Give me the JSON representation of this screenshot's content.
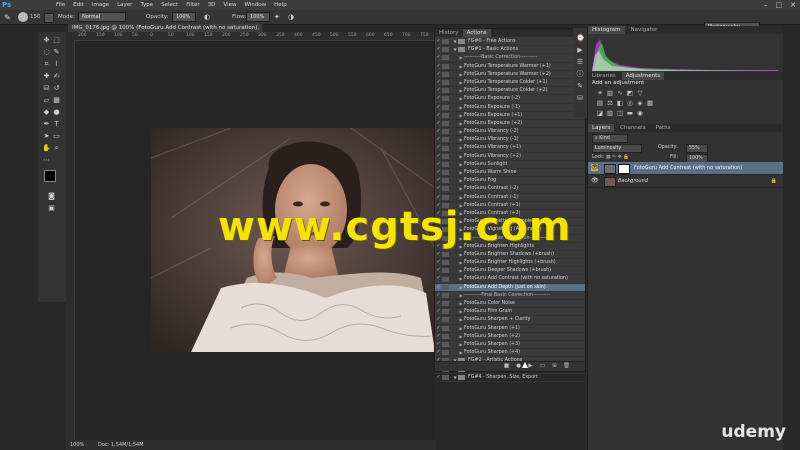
{
  "app": {
    "logo": "Ps",
    "menus": [
      "File",
      "Edit",
      "Image",
      "Layer",
      "Type",
      "Select",
      "Filter",
      "3D",
      "View",
      "Window",
      "Help"
    ],
    "window_controls": [
      "–",
      "□",
      "✕"
    ]
  },
  "options_bar": {
    "size_value": "150",
    "mode_label": "Mode:",
    "mode_value": "Normal",
    "opacity_label": "Opacity:",
    "opacity_value": "100%",
    "flow_label": "Flow:",
    "flow_value": "100%",
    "workspace": "Photography"
  },
  "document": {
    "tab_title": "IMG_0176.jpg @ 100% (FotoGuru Add Contrast (with no saturation), RGB/8) *",
    "zoom": "100%",
    "doc_size": "Doc: 1,54M/1,54M"
  },
  "ruler_ticks": [
    "200",
    "150",
    "100",
    "50",
    "0",
    "50",
    "100",
    "150",
    "200",
    "250",
    "300",
    "350",
    "400",
    "450",
    "500",
    "550",
    "600",
    "650",
    "700",
    "750"
  ],
  "actions_panel": {
    "tabs": [
      "History",
      "Actions"
    ],
    "rows": [
      {
        "check": "✓",
        "kind": "set",
        "label": "FG#0 - Free Actions"
      },
      {
        "check": "✓",
        "kind": "set",
        "label": "FG#1 - Basic Actions"
      },
      {
        "check": "✓",
        "kind": "sep",
        "label": "----------Basic Correction----------"
      },
      {
        "check": "✓",
        "kind": "action",
        "label": "FotoGuru Temperature Warmer (+1)"
      },
      {
        "check": "✓",
        "kind": "action",
        "label": "FotoGuru Temperature Warmer (+2)"
      },
      {
        "check": "✓",
        "kind": "action",
        "label": "FotoGuru Temperature Colder (+1)"
      },
      {
        "check": "✓",
        "kind": "action",
        "label": "FotoGuru Temperature Colder (+2)"
      },
      {
        "check": "✓",
        "kind": "action",
        "label": "FotoGuru Exposure (-2)"
      },
      {
        "check": "✓",
        "kind": "action",
        "label": "FotoGuru Exposure (-1)"
      },
      {
        "check": "✓",
        "kind": "action",
        "label": "FotoGuru Exposure (+1)"
      },
      {
        "check": "✓",
        "kind": "action",
        "label": "FotoGuru Exposure (+2)"
      },
      {
        "check": "✓",
        "kind": "action",
        "label": "FotoGuru Vibrancy (-2)"
      },
      {
        "check": "✓",
        "kind": "action",
        "label": "FotoGuru Vibrancy (-1)"
      },
      {
        "check": "✓",
        "kind": "action",
        "label": "FotoGuru Vibrancy (+1)"
      },
      {
        "check": "✓",
        "kind": "action",
        "label": "FotoGuru Vibrancy (+2)"
      },
      {
        "check": "✓",
        "kind": "action",
        "label": "FotoGuru Sunlight"
      },
      {
        "check": "✓",
        "kind": "action",
        "label": "FotoGuru Warm Shine"
      },
      {
        "check": "✓",
        "kind": "action",
        "label": "FotoGuru Fog"
      },
      {
        "check": "✓",
        "kind": "action",
        "label": "FotoGuru Contrast (-2)"
      },
      {
        "check": "✓",
        "kind": "action",
        "label": "FotoGuru Contrast (-1)"
      },
      {
        "check": "✓",
        "kind": "action",
        "label": "FotoGuru Contrast (+1)"
      },
      {
        "check": "✓",
        "kind": "action",
        "label": "FotoGuru Contrast (+2)"
      },
      {
        "check": "✓",
        "kind": "action",
        "label": "FotoGuru Vignetting (Simple)"
      },
      {
        "check": "✓",
        "kind": "action",
        "label": "FotoGuru Vignetting (Advanced)"
      },
      {
        "check": "✓",
        "kind": "sep",
        "label": "----------Selective Correction----------"
      },
      {
        "check": "✓",
        "kind": "action",
        "label": "FotoGuru Brighten Highlights"
      },
      {
        "check": "✓",
        "kind": "action",
        "label": "FotoGuru Brighten Shadows (+brush)"
      },
      {
        "check": "✓",
        "kind": "action",
        "label": "FotoGuru Brighter Highlights (+brush)"
      },
      {
        "check": "✓",
        "kind": "action",
        "label": "FotoGuru Deeper Shadows (+brush)"
      },
      {
        "check": "✓",
        "kind": "action",
        "label": "FotoGuru Add Contrast (with no saturation)"
      },
      {
        "check": "✓",
        "kind": "action",
        "label": "FotoGuru Add Depth (just on skin)",
        "selected": true
      },
      {
        "check": "✓",
        "kind": "sep",
        "label": "----------Final Basic Correction----------"
      },
      {
        "check": "✓",
        "kind": "action",
        "label": "FotoGuru Color Noise"
      },
      {
        "check": "✓",
        "kind": "action",
        "label": "FotoGuru Film Grain"
      },
      {
        "check": "✓",
        "kind": "action",
        "label": "FotoGuru Sharpen + Clarity"
      },
      {
        "check": "✓",
        "kind": "action",
        "label": "FotoGuru Sharpen (+1)"
      },
      {
        "check": "✓",
        "kind": "action",
        "label": "FotoGuru Sharpen (+2)"
      },
      {
        "check": "✓",
        "kind": "action",
        "label": "FotoGuru Sharpen (+3)"
      },
      {
        "check": "✓",
        "kind": "action",
        "label": "FotoGuru Sharpen (+4)"
      },
      {
        "check": "✓",
        "kind": "set",
        "label": "FG#2 - Artistic Actions"
      },
      {
        "check": "✓",
        "kind": "set",
        "label": "FG#3 - Retouch"
      },
      {
        "check": "✓",
        "kind": "set",
        "label": "FG#4 - Sharpen, Size, Export"
      }
    ]
  },
  "right_panels": {
    "top_tabs": [
      "Histogram",
      "Navigator"
    ],
    "mid_tabs": [
      "Libraries",
      "Adjustments"
    ],
    "adjustments_title": "Add an adjustment",
    "layer_tabs": [
      "Layers",
      "Channels",
      "Paths"
    ],
    "kind_label": "Kind",
    "blend_mode": "Luminosity",
    "opacity_label": "Opacity:",
    "opacity_value": "55%",
    "lock_label": "Lock:",
    "fill_label": "Fill:",
    "fill_value": "100%",
    "layers": [
      {
        "name": "FotoGuru Add Contrast (with no saturation)",
        "selected": true
      },
      {
        "name": "Background",
        "selected": false
      }
    ]
  },
  "overlay": {
    "watermark": "www.cgtsj.com",
    "brand": "udemy"
  },
  "colors": {
    "accent_selection": "#5b6f86",
    "watermark": "#f5e400",
    "ps_blue": "#31a8ff"
  }
}
